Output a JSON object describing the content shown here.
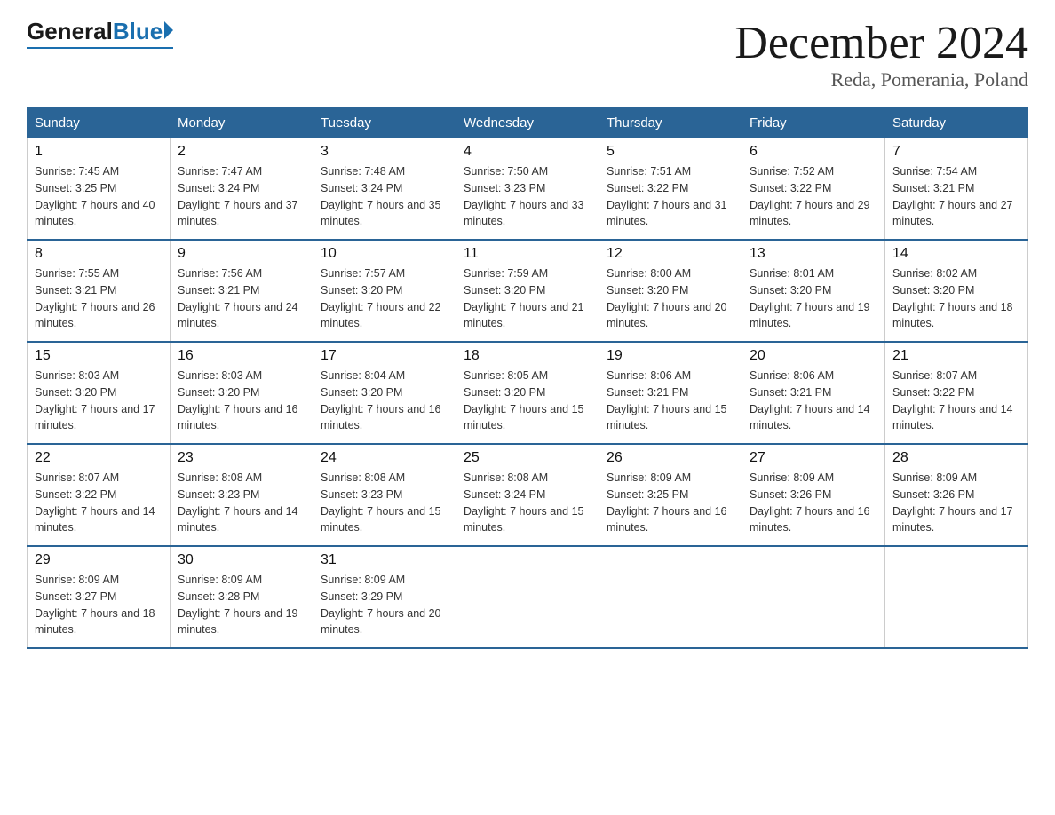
{
  "logo": {
    "general": "General",
    "blue": "Blue"
  },
  "title": {
    "month": "December 2024",
    "location": "Reda, Pomerania, Poland"
  },
  "header": {
    "days": [
      "Sunday",
      "Monday",
      "Tuesday",
      "Wednesday",
      "Thursday",
      "Friday",
      "Saturday"
    ]
  },
  "weeks": [
    [
      {
        "day": "1",
        "sunrise": "7:45 AM",
        "sunset": "3:25 PM",
        "daylight": "7 hours and 40 minutes."
      },
      {
        "day": "2",
        "sunrise": "7:47 AM",
        "sunset": "3:24 PM",
        "daylight": "7 hours and 37 minutes."
      },
      {
        "day": "3",
        "sunrise": "7:48 AM",
        "sunset": "3:24 PM",
        "daylight": "7 hours and 35 minutes."
      },
      {
        "day": "4",
        "sunrise": "7:50 AM",
        "sunset": "3:23 PM",
        "daylight": "7 hours and 33 minutes."
      },
      {
        "day": "5",
        "sunrise": "7:51 AM",
        "sunset": "3:22 PM",
        "daylight": "7 hours and 31 minutes."
      },
      {
        "day": "6",
        "sunrise": "7:52 AM",
        "sunset": "3:22 PM",
        "daylight": "7 hours and 29 minutes."
      },
      {
        "day": "7",
        "sunrise": "7:54 AM",
        "sunset": "3:21 PM",
        "daylight": "7 hours and 27 minutes."
      }
    ],
    [
      {
        "day": "8",
        "sunrise": "7:55 AM",
        "sunset": "3:21 PM",
        "daylight": "7 hours and 26 minutes."
      },
      {
        "day": "9",
        "sunrise": "7:56 AM",
        "sunset": "3:21 PM",
        "daylight": "7 hours and 24 minutes."
      },
      {
        "day": "10",
        "sunrise": "7:57 AM",
        "sunset": "3:20 PM",
        "daylight": "7 hours and 22 minutes."
      },
      {
        "day": "11",
        "sunrise": "7:59 AM",
        "sunset": "3:20 PM",
        "daylight": "7 hours and 21 minutes."
      },
      {
        "day": "12",
        "sunrise": "8:00 AM",
        "sunset": "3:20 PM",
        "daylight": "7 hours and 20 minutes."
      },
      {
        "day": "13",
        "sunrise": "8:01 AM",
        "sunset": "3:20 PM",
        "daylight": "7 hours and 19 minutes."
      },
      {
        "day": "14",
        "sunrise": "8:02 AM",
        "sunset": "3:20 PM",
        "daylight": "7 hours and 18 minutes."
      }
    ],
    [
      {
        "day": "15",
        "sunrise": "8:03 AM",
        "sunset": "3:20 PM",
        "daylight": "7 hours and 17 minutes."
      },
      {
        "day": "16",
        "sunrise": "8:03 AM",
        "sunset": "3:20 PM",
        "daylight": "7 hours and 16 minutes."
      },
      {
        "day": "17",
        "sunrise": "8:04 AM",
        "sunset": "3:20 PM",
        "daylight": "7 hours and 16 minutes."
      },
      {
        "day": "18",
        "sunrise": "8:05 AM",
        "sunset": "3:20 PM",
        "daylight": "7 hours and 15 minutes."
      },
      {
        "day": "19",
        "sunrise": "8:06 AM",
        "sunset": "3:21 PM",
        "daylight": "7 hours and 15 minutes."
      },
      {
        "day": "20",
        "sunrise": "8:06 AM",
        "sunset": "3:21 PM",
        "daylight": "7 hours and 14 minutes."
      },
      {
        "day": "21",
        "sunrise": "8:07 AM",
        "sunset": "3:22 PM",
        "daylight": "7 hours and 14 minutes."
      }
    ],
    [
      {
        "day": "22",
        "sunrise": "8:07 AM",
        "sunset": "3:22 PM",
        "daylight": "7 hours and 14 minutes."
      },
      {
        "day": "23",
        "sunrise": "8:08 AM",
        "sunset": "3:23 PM",
        "daylight": "7 hours and 14 minutes."
      },
      {
        "day": "24",
        "sunrise": "8:08 AM",
        "sunset": "3:23 PM",
        "daylight": "7 hours and 15 minutes."
      },
      {
        "day": "25",
        "sunrise": "8:08 AM",
        "sunset": "3:24 PM",
        "daylight": "7 hours and 15 minutes."
      },
      {
        "day": "26",
        "sunrise": "8:09 AM",
        "sunset": "3:25 PM",
        "daylight": "7 hours and 16 minutes."
      },
      {
        "day": "27",
        "sunrise": "8:09 AM",
        "sunset": "3:26 PM",
        "daylight": "7 hours and 16 minutes."
      },
      {
        "day": "28",
        "sunrise": "8:09 AM",
        "sunset": "3:26 PM",
        "daylight": "7 hours and 17 minutes."
      }
    ],
    [
      {
        "day": "29",
        "sunrise": "8:09 AM",
        "sunset": "3:27 PM",
        "daylight": "7 hours and 18 minutes."
      },
      {
        "day": "30",
        "sunrise": "8:09 AM",
        "sunset": "3:28 PM",
        "daylight": "7 hours and 19 minutes."
      },
      {
        "day": "31",
        "sunrise": "8:09 AM",
        "sunset": "3:29 PM",
        "daylight": "7 hours and 20 minutes."
      },
      null,
      null,
      null,
      null
    ]
  ]
}
